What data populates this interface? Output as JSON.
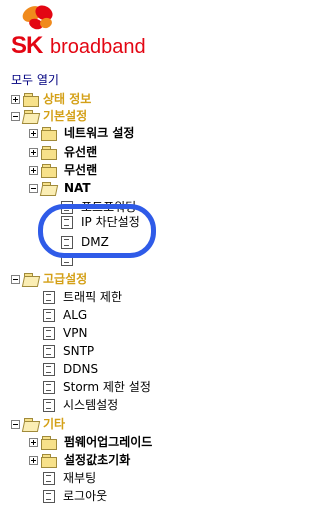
{
  "header": {
    "brand_sk": "SK",
    "brand_broadband": "broadband"
  },
  "tree": {
    "open_all": "모두 열기",
    "items": [
      {
        "label": "상태 정보",
        "type": "category"
      },
      {
        "label": "기본설정",
        "type": "category"
      },
      {
        "label": "네트워크 설정",
        "type": "folder"
      },
      {
        "label": "유선랜",
        "type": "folder"
      },
      {
        "label": "무선랜",
        "type": "folder"
      },
      {
        "label": "NAT",
        "type": "folder"
      },
      {
        "label": "포트포워딩",
        "type": "page"
      },
      {
        "label": "IP 차단설정",
        "type": "page"
      },
      {
        "label": "DMZ",
        "type": "page"
      },
      {
        "label": "",
        "type": "page"
      },
      {
        "label": "고급설정",
        "type": "category"
      },
      {
        "label": "트래픽 제한",
        "type": "page"
      },
      {
        "label": "ALG",
        "type": "page"
      },
      {
        "label": "VPN",
        "type": "page"
      },
      {
        "label": "SNTP",
        "type": "page"
      },
      {
        "label": "DDNS",
        "type": "page"
      },
      {
        "label": "Storm 제한 설정",
        "type": "page"
      },
      {
        "label": "시스템설정",
        "type": "page"
      },
      {
        "label": "기타",
        "type": "category"
      },
      {
        "label": "펌웨어업그레이드",
        "type": "folder"
      },
      {
        "label": "설정값초기화",
        "type": "folder"
      },
      {
        "label": "재부팅",
        "type": "page"
      },
      {
        "label": "로그아웃",
        "type": "page"
      }
    ]
  },
  "annotation": {
    "color": "#2f5be8"
  }
}
